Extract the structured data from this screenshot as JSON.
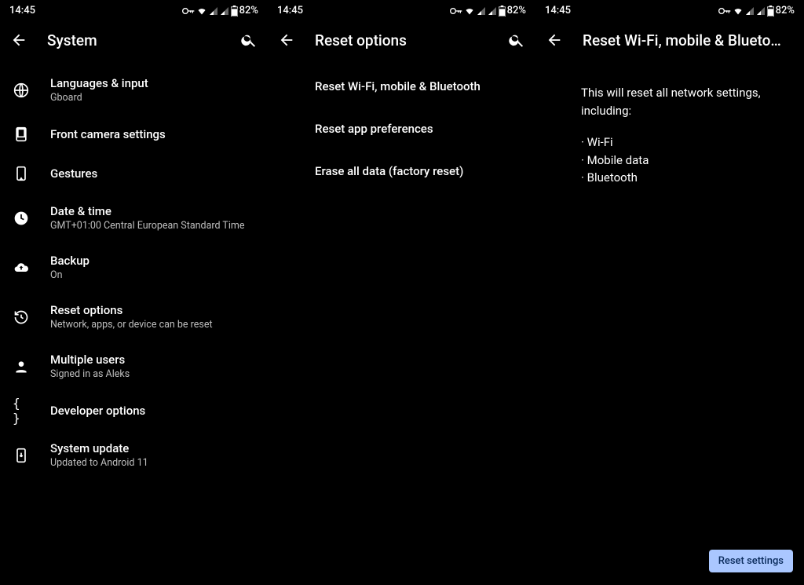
{
  "statusbar": {
    "time": "14:45",
    "battery": "82%"
  },
  "screen1": {
    "title": "System",
    "items": [
      {
        "label": "Languages & input",
        "sub": "Gboard"
      },
      {
        "label": "Front camera settings",
        "sub": ""
      },
      {
        "label": "Gestures",
        "sub": ""
      },
      {
        "label": "Date & time",
        "sub": "GMT+01:00 Central European Standard Time"
      },
      {
        "label": "Backup",
        "sub": "On"
      },
      {
        "label": "Reset options",
        "sub": "Network, apps, or device can be reset"
      },
      {
        "label": "Multiple users",
        "sub": "Signed in as Aleks"
      },
      {
        "label": "Developer options",
        "sub": ""
      },
      {
        "label": "System update",
        "sub": "Updated to Android 11"
      }
    ]
  },
  "screen2": {
    "title": "Reset options",
    "items": [
      {
        "label": "Reset Wi-Fi, mobile & Bluetooth"
      },
      {
        "label": "Reset app preferences"
      },
      {
        "label": "Erase all data (factory reset)"
      }
    ]
  },
  "screen3": {
    "title": "Reset Wi-Fi, mobile & Blueto…",
    "lead": "This will reset all network settings, including:",
    "bullets": [
      "Wi-Fi",
      "Mobile data",
      "Bluetooth"
    ],
    "button": "Reset settings"
  }
}
